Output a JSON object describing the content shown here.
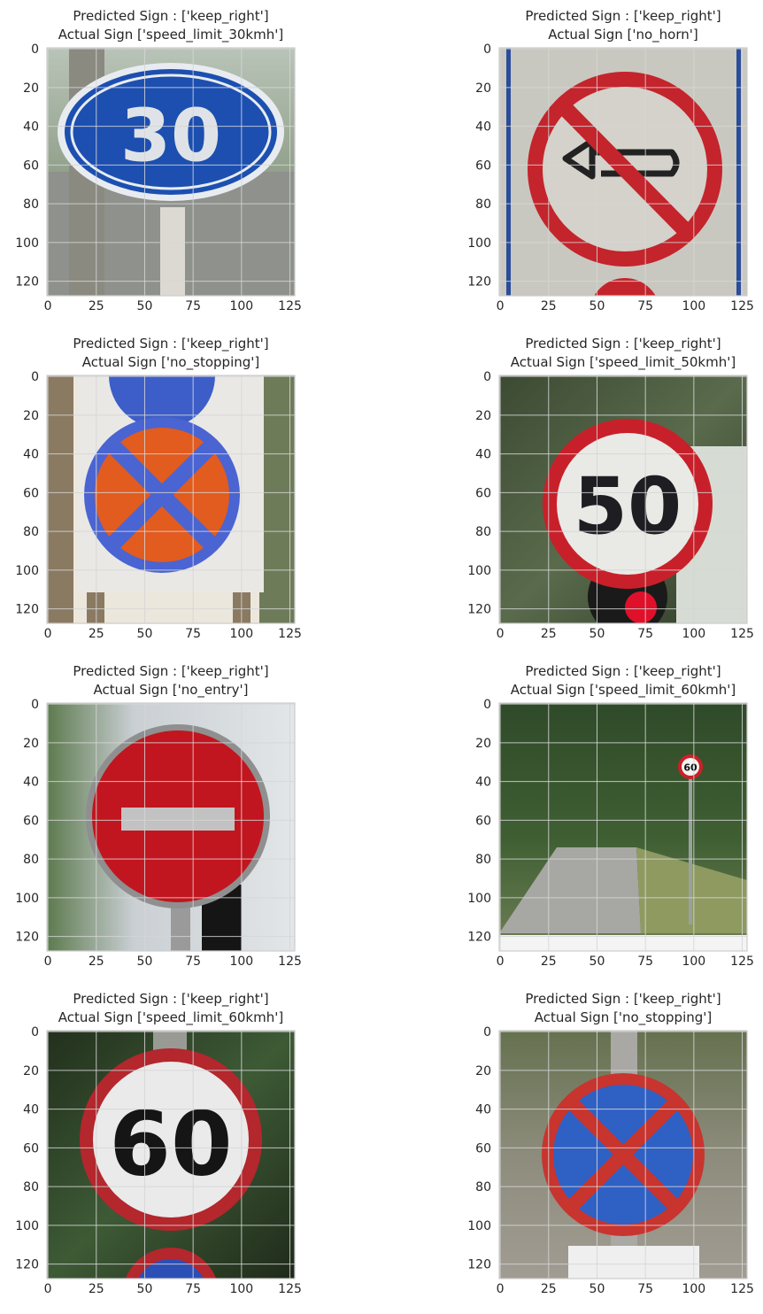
{
  "chart_data": [
    {
      "type": "image",
      "title_line1": "Predicted Sign : ['keep_right']",
      "title_line2": "Actual Sign ['speed_limit_30kmh']",
      "x_ticks": [
        0,
        25,
        50,
        75,
        100,
        125
      ],
      "y_ticks": [
        0,
        20,
        40,
        60,
        80,
        100,
        120
      ],
      "xlim": [
        -0.5,
        127.5
      ],
      "ylim": [
        127.5,
        -0.5
      ],
      "grid": true,
      "image_content": {
        "kind": "sign-ellipse-blue",
        "text": "30",
        "bg": "street-greenery"
      }
    },
    {
      "type": "image",
      "title_line1": "Predicted Sign : ['keep_right']",
      "title_line2": "Actual Sign ['no_horn']",
      "x_ticks": [
        0,
        25,
        50,
        75,
        100,
        125
      ],
      "y_ticks": [
        0,
        20,
        40,
        60,
        80,
        100,
        120
      ],
      "xlim": [
        -0.5,
        127.5
      ],
      "ylim": [
        127.5,
        -0.5
      ],
      "grid": true,
      "image_content": {
        "kind": "sign-no-horn",
        "bg": "grey-panel"
      }
    },
    {
      "type": "image",
      "title_line1": "Predicted Sign : ['keep_right']",
      "title_line2": "Actual Sign ['no_stopping']",
      "x_ticks": [
        0,
        25,
        50,
        75,
        100,
        125
      ],
      "y_ticks": [
        0,
        20,
        40,
        60,
        80,
        100,
        120
      ],
      "xlim": [
        -0.5,
        127.5
      ],
      "ylim": [
        127.5,
        -0.5
      ],
      "grid": true,
      "image_content": {
        "kind": "sign-no-stopping-orange",
        "bg": "white-board"
      }
    },
    {
      "type": "image",
      "title_line1": "Predicted Sign : ['keep_right']",
      "title_line2": "Actual Sign ['speed_limit_50kmh']",
      "x_ticks": [
        0,
        25,
        50,
        75,
        100,
        125
      ],
      "y_ticks": [
        0,
        20,
        40,
        60,
        80,
        100,
        120
      ],
      "xlim": [
        -0.5,
        127.5
      ],
      "ylim": [
        127.5,
        -0.5
      ],
      "grid": true,
      "image_content": {
        "kind": "sign-speed-round",
        "text": "50",
        "bg": "dark-greenery"
      }
    },
    {
      "type": "image",
      "title_line1": "Predicted Sign : ['keep_right']",
      "title_line2": "Actual Sign ['no_entry']",
      "x_ticks": [
        0,
        25,
        50,
        75,
        100,
        125
      ],
      "y_ticks": [
        0,
        20,
        40,
        60,
        80,
        100,
        120
      ],
      "xlim": [
        -0.5,
        127.5
      ],
      "ylim": [
        127.5,
        -0.5
      ],
      "grid": true,
      "image_content": {
        "kind": "sign-no-entry",
        "bg": "building"
      }
    },
    {
      "type": "image",
      "title_line1": "Predicted Sign : ['keep_right']",
      "title_line2": "Actual Sign ['speed_limit_60kmh']",
      "x_ticks": [
        0,
        25,
        50,
        75,
        100,
        125
      ],
      "y_ticks": [
        0,
        20,
        40,
        60,
        80,
        100,
        120
      ],
      "xlim": [
        -0.5,
        127.5
      ],
      "ylim": [
        127.5,
        -0.5
      ],
      "grid": true,
      "image_content": {
        "kind": "sign-small-road",
        "text": "60",
        "bg": "forest-road"
      }
    },
    {
      "type": "image",
      "title_line1": "Predicted Sign : ['keep_right']",
      "title_line2": "Actual Sign ['speed_limit_60kmh']",
      "x_ticks": [
        0,
        25,
        50,
        75,
        100,
        125
      ],
      "y_ticks": [
        0,
        20,
        40,
        60,
        80,
        100,
        120
      ],
      "xlim": [
        -0.5,
        127.5
      ],
      "ylim": [
        127.5,
        -0.5
      ],
      "grid": true,
      "image_content": {
        "kind": "sign-speed-round",
        "text": "60",
        "bg": "trees"
      }
    },
    {
      "type": "image",
      "title_line1": "Predicted Sign : ['keep_right']",
      "title_line2": "Actual Sign ['no_stopping']",
      "x_ticks": [
        0,
        25,
        50,
        75,
        100,
        125
      ],
      "y_ticks": [
        0,
        20,
        40,
        60,
        80,
        100,
        120
      ],
      "xlim": [
        -0.5,
        127.5
      ],
      "ylim": [
        127.5,
        -0.5
      ],
      "grid": true,
      "image_content": {
        "kind": "sign-no-stopping-blue",
        "bg": "pole-trees"
      }
    }
  ]
}
